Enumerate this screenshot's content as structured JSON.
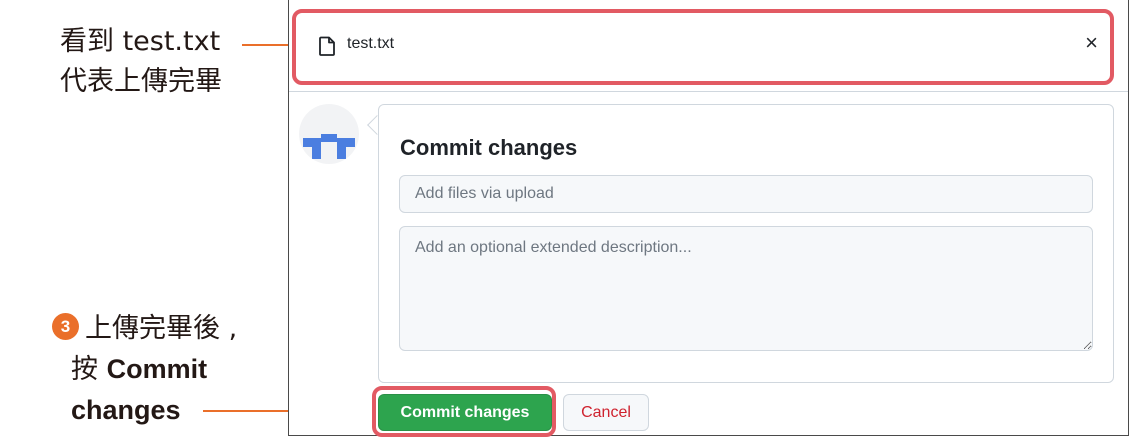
{
  "annotations": {
    "top_line1": "看到 test.txt",
    "top_line2": "代表上傳完畢",
    "step_number": "3",
    "bottom_line1": "上傳完畢後 ,",
    "bottom_line2_prefix": "按 ",
    "bottom_line2_bold": "Commit",
    "bottom_line3_bold": "changes"
  },
  "file": {
    "icon": "file-icon",
    "name": "test.txt",
    "close": "×"
  },
  "commit": {
    "avatar": "identicon-avatar",
    "title": "Commit changes",
    "summary_placeholder": "Add files via upload",
    "summary_value": "",
    "description_placeholder": "Add an optional extended description...",
    "description_value": ""
  },
  "buttons": {
    "commit_label": "Commit changes",
    "cancel_label": "Cancel"
  },
  "colors": {
    "highlight": "#e25a63",
    "annotation_accent": "#ea6f2a",
    "commit_button": "#2da44e",
    "cancel_text": "#cf222e"
  }
}
